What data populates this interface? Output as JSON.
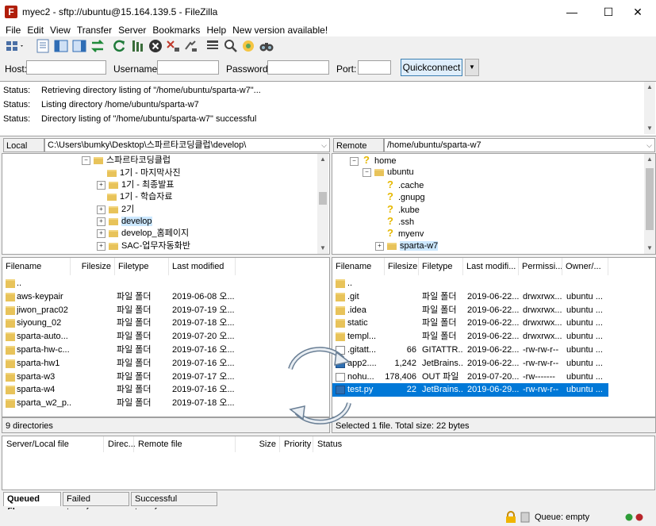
{
  "window": {
    "title": "myec2 - sftp://ubuntu@15.164.139.5 - FileZilla",
    "app_icon": "filezilla-icon",
    "minimize": "—",
    "maximize": "☐",
    "close": "✕"
  },
  "menu": [
    "File",
    "Edit",
    "View",
    "Transfer",
    "Server",
    "Bookmarks",
    "Help",
    "New version available!"
  ],
  "quickconnect": {
    "host_label": "Host:",
    "host_value": "",
    "username_label": "Username:",
    "username_value": "",
    "password_label": "Password:",
    "password_value": "",
    "port_label": "Port:",
    "port_value": "",
    "button": "Quickconnect",
    "dropdown": "▼"
  },
  "log": [
    {
      "label": "Status:",
      "text": "Retrieving directory listing of \"/home/ubuntu/sparta-w7\"..."
    },
    {
      "label": "Status:",
      "text": "Listing directory /home/ubuntu/sparta-w7"
    },
    {
      "label": "Status:",
      "text": "Directory listing of \"/home/ubuntu/sparta-w7\" successful"
    }
  ],
  "local": {
    "site_label": "Local site:",
    "site_path": "C:\\Users\\bumky\\Desktop\\스파르타코딩클럽\\develop\\",
    "tree": [
      {
        "label": "스파르타코딩클럽",
        "expander": "⊟"
      },
      {
        "label": "1기 - 마지막사진",
        "expander": ""
      },
      {
        "label": "1기 - 최종발표",
        "expander": "⊞"
      },
      {
        "label": "1기 - 학습자료",
        "expander": ""
      },
      {
        "label": "2기",
        "expander": "⊞"
      },
      {
        "label": "develop",
        "expander": "⊞"
      },
      {
        "label": "develop_홈페이지",
        "expander": "⊞"
      },
      {
        "label": "SAC-업무자동화반",
        "expander": "⊞"
      }
    ],
    "columns": [
      "Filename",
      "Filesize",
      "Filetype",
      "Last modified"
    ],
    "files": [
      {
        "name": "..",
        "size": "",
        "type": "",
        "modified": ""
      },
      {
        "name": "aws-keypair",
        "size": "",
        "type": "파일 폴더",
        "modified": "2019-06-08 오..."
      },
      {
        "name": "jiwon_prac02",
        "size": "",
        "type": "파일 폴더",
        "modified": "2019-07-19 오..."
      },
      {
        "name": "siyoung_02",
        "size": "",
        "type": "파일 폴더",
        "modified": "2019-07-18 오..."
      },
      {
        "name": "sparta-auto...",
        "size": "",
        "type": "파일 폴더",
        "modified": "2019-07-20 오..."
      },
      {
        "name": "sparta-hw-c...",
        "size": "",
        "type": "파일 폴더",
        "modified": "2019-07-16 오..."
      },
      {
        "name": "sparta-hw1",
        "size": "",
        "type": "파일 폴더",
        "modified": "2019-07-16 오..."
      },
      {
        "name": "sparta-w3",
        "size": "",
        "type": "파일 폴더",
        "modified": "2019-07-17 오..."
      },
      {
        "name": "sparta-w4",
        "size": "",
        "type": "파일 폴더",
        "modified": "2019-07-16 오..."
      },
      {
        "name": "sparta_w2_p...",
        "size": "",
        "type": "파일 폴더",
        "modified": "2019-07-18 오..."
      }
    ],
    "status": "9 directories"
  },
  "remote": {
    "site_label": "Remote site:",
    "site_path": "/home/ubuntu/sparta-w7",
    "tree": [
      {
        "label": "home",
        "kind": "qmark",
        "expander": "⊟"
      },
      {
        "label": "ubuntu",
        "kind": "folder",
        "expander": "⊟"
      },
      {
        "label": ".cache",
        "kind": "qmark",
        "expander": ""
      },
      {
        "label": ".gnupg",
        "kind": "qmark",
        "expander": ""
      },
      {
        "label": ".kube",
        "kind": "qmark",
        "expander": ""
      },
      {
        "label": ".ssh",
        "kind": "qmark",
        "expander": ""
      },
      {
        "label": "myenv",
        "kind": "qmark",
        "expander": ""
      },
      {
        "label": "sparta-w7",
        "kind": "folder",
        "expander": "⊞"
      }
    ],
    "columns": [
      "Filename",
      "Filesize",
      "Filetype",
      "Last modifi...",
      "Permissi...",
      "Owner/..."
    ],
    "files": [
      {
        "name": "..",
        "size": "",
        "type": "",
        "modified": "",
        "perm": "",
        "owner": "",
        "icon": "folder"
      },
      {
        "name": ".git",
        "size": "",
        "type": "파일 폴더",
        "modified": "2019-06-22...",
        "perm": "drwxrwx...",
        "owner": "ubuntu ...",
        "icon": "folder"
      },
      {
        "name": ".idea",
        "size": "",
        "type": "파일 폴더",
        "modified": "2019-06-22...",
        "perm": "drwxrwx...",
        "owner": "ubuntu ...",
        "icon": "folder"
      },
      {
        "name": "static",
        "size": "",
        "type": "파일 폴더",
        "modified": "2019-06-22...",
        "perm": "drwxrwx...",
        "owner": "ubuntu ...",
        "icon": "folder"
      },
      {
        "name": "templ...",
        "size": "",
        "type": "파일 폴더",
        "modified": "2019-06-22...",
        "perm": "drwxrwx...",
        "owner": "ubuntu ...",
        "icon": "folder"
      },
      {
        "name": ".gitatt...",
        "size": "66",
        "type": "GITATTR...",
        "modified": "2019-06-22...",
        "perm": "-rw-rw-r--",
        "owner": "ubuntu ...",
        "icon": "file"
      },
      {
        "name": "app2....",
        "size": "1,242",
        "type": "JetBrains...",
        "modified": "2019-06-22...",
        "perm": "-rw-rw-r--",
        "owner": "ubuntu ...",
        "icon": "pyfile"
      },
      {
        "name": "nohu...",
        "size": "178,406",
        "type": "OUT 파일",
        "modified": "2019-07-20...",
        "perm": "-rw-------",
        "owner": "ubuntu ...",
        "icon": "file"
      },
      {
        "name": "test.py",
        "size": "22",
        "type": "JetBrains...",
        "modified": "2019-06-29...",
        "perm": "-rw-rw-r--",
        "owner": "ubuntu ...",
        "icon": "pyfile",
        "selected": true
      }
    ],
    "status": "Selected 1 file. Total size: 22 bytes"
  },
  "queue": {
    "columns": [
      "Server/Local file",
      "Direc...",
      "Remote file",
      "Size",
      "Priority",
      "Status"
    ],
    "tabs": [
      "Queued files",
      "Failed transfers",
      "Successful transfers"
    ]
  },
  "statusbar": {
    "queue": "Queue: empty",
    "lock_icon": "lock-icon"
  },
  "colors": {
    "selection": "#0078d7",
    "folder": "#e8c35a",
    "quickconnect_border": "#3c7fb1"
  }
}
